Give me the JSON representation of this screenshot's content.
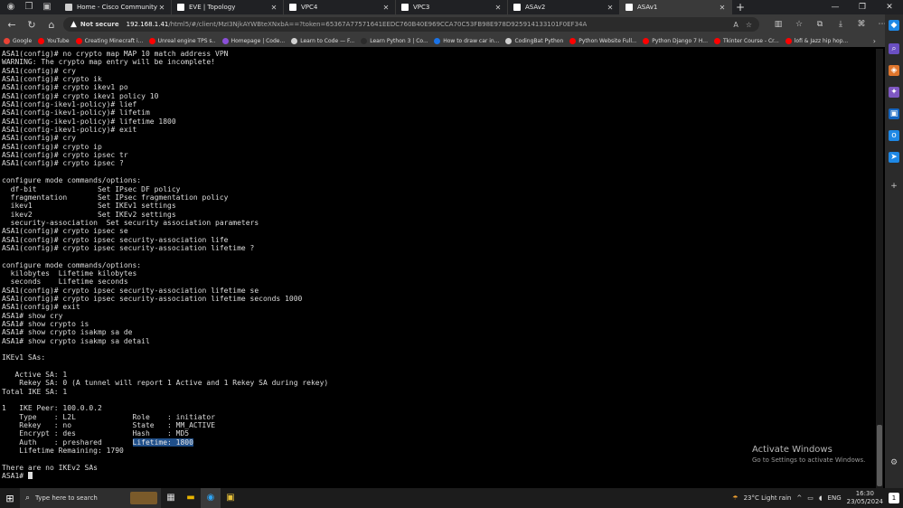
{
  "browser": {
    "tabs": [
      {
        "label": "Home - Cisco Community",
        "fav_color": "#cfcfcf",
        "active": false
      },
      {
        "label": "EVE | Topology",
        "fav_color": "#ffffff",
        "active": false
      },
      {
        "label": "VPC4",
        "fav_color": "#ffffff",
        "active": false
      },
      {
        "label": "VPC3",
        "fav_color": "#ffffff",
        "active": false
      },
      {
        "label": "ASAv2",
        "fav_color": "#ffffff",
        "active": false
      },
      {
        "label": "ASAv1",
        "fav_color": "#ffffff",
        "active": true
      }
    ],
    "new_tab": "+",
    "address": {
      "warning": "Not secure",
      "host": "192.168.1.41",
      "path": "/html5/#/client/MzI3NjkAYWBteXNxbA==?token=65367A77571641EEDC760B40E969CCA70C53FB98E978D925914133101F0EF34A"
    },
    "bookmarks": [
      {
        "label": "Google",
        "color": "#ea4335"
      },
      {
        "label": "YouTube",
        "color": "#ff0000"
      },
      {
        "label": "Creating Minecraft i...",
        "color": "#ff0000"
      },
      {
        "label": "Unreal engine TPS s...",
        "color": "#ff0000"
      },
      {
        "label": "Homepage | Code...",
        "color": "#8a4fd8"
      },
      {
        "label": "Learn to Code — F...",
        "color": "#d0d0d0"
      },
      {
        "label": "Learn Python 3 | Co...",
        "color": "#2b2b2b"
      },
      {
        "label": "How to draw car in...",
        "color": "#1a73e8"
      },
      {
        "label": "CodingBat Python",
        "color": "#d0d0d0"
      },
      {
        "label": "Python Website Full...",
        "color": "#ff0000"
      },
      {
        "label": "Python Django 7 H...",
        "color": "#ff0000"
      },
      {
        "label": "Tkinter Course - Cr...",
        "color": "#ff0000"
      },
      {
        "label": "lofi & Jazz hip hop...",
        "color": "#ff0000"
      }
    ]
  },
  "terminal": {
    "lines": [
      "ASA1(config)# no crypto map MAP 10 match address VPN",
      "WARNING: The crypto map entry will be incomplete!",
      "ASA1(config)# cry",
      "ASA1(config)# crypto ik",
      "ASA1(config)# crypto ikev1 po",
      "ASA1(config)# crypto ikev1 policy 10",
      "ASA1(config-ikev1-policy)# lief",
      "ASA1(config-ikev1-policy)# lifetim",
      "ASA1(config-ikev1-policy)# lifetime 1800",
      "ASA1(config-ikev1-policy)# exit",
      "ASA1(config)# cry",
      "ASA1(config)# crypto ip",
      "ASA1(config)# crypto ipsec tr",
      "ASA1(config)# crypto ipsec ?",
      "",
      "configure mode commands/options:",
      "  df-bit              Set IPsec DF policy",
      "  fragmentation       Set IPsec fragmentation policy",
      "  ikev1               Set IKEv1 settings",
      "  ikev2               Set IKEv2 settings",
      "  security-association  Set security association parameters",
      "ASA1(config)# crypto ipsec se",
      "ASA1(config)# crypto ipsec security-association life",
      "ASA1(config)# crypto ipsec security-association lifetime ?",
      "",
      "configure mode commands/options:",
      "  kilobytes  Lifetime kilobytes",
      "  seconds    Lifetime seconds",
      "ASA1(config)# crypto ipsec security-association lifetime se",
      "ASA1(config)# crypto ipsec security-association lifetime seconds 1000",
      "ASA1(config)# exit",
      "ASA1# show cry",
      "ASA1# show crypto is",
      "ASA1# show crypto isakmp sa de",
      "ASA1# show crypto isakmp sa detail",
      "",
      "IKEv1 SAs:",
      "",
      "   Active SA: 1",
      "    Rekey SA: 0 (A tunnel will report 1 Active and 1 Rekey SA during rekey)",
      "Total IKE SA: 1",
      "",
      "1   IKE Peer: 100.0.0.2",
      "    Type    : L2L             Role    : initiator",
      "    Rekey   : no              State   : MM_ACTIVE",
      "    Encrypt : des             Hash    : MD5",
      "    Auth    : preshared       ",
      "    Lifetime Remaining: 1790",
      "",
      "There are no IKEv2 SAs",
      "ASA1# "
    ],
    "highlight_line_index": 46,
    "highlight_text": "Lifetime: 1800",
    "cursor_line_index": 50
  },
  "watermark": {
    "title": "Activate Windows",
    "subtitle": "Go to Settings to activate Windows."
  },
  "taskbar": {
    "search_placeholder": "Type here to search",
    "weather": "23°C  Light rain",
    "language": "ENG",
    "time": "16:30",
    "date": "23/05/2024",
    "notification_count": "1"
  }
}
